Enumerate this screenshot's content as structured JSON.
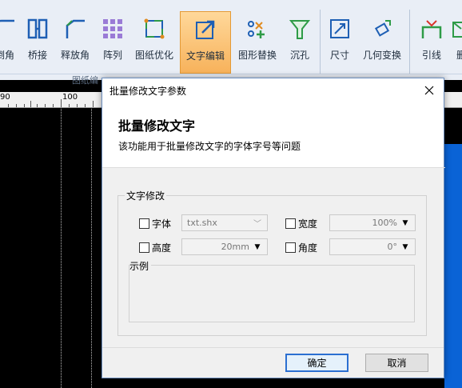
{
  "ribbon": {
    "buttons": [
      {
        "label": "倒角",
        "icon": "chamfer-icon"
      },
      {
        "label": "桥接",
        "icon": "bridge-icon"
      },
      {
        "label": "释放角",
        "icon": "release-corner-icon"
      },
      {
        "label": "阵列",
        "icon": "array-icon"
      },
      {
        "label": "图纸优化",
        "icon": "drawing-optimize-icon"
      },
      {
        "label": "文字编辑",
        "icon": "text-edit-icon"
      },
      {
        "label": "图形替换",
        "icon": "shape-replace-icon"
      },
      {
        "label": "沉孔",
        "icon": "countersink-icon"
      },
      {
        "label": "尺寸",
        "icon": "dimension-icon"
      },
      {
        "label": "几何变换",
        "icon": "geometry-transform-icon"
      },
      {
        "label": "引线",
        "icon": "leader-icon"
      },
      {
        "label": "删",
        "icon": "delete-icon"
      }
    ],
    "group_label": "图纸编"
  },
  "ruler": {
    "labels": [
      "90",
      "100"
    ]
  },
  "dialog": {
    "title": "批量修改文字参数",
    "heading": "批量修改文字",
    "description": "该功能用于批量修改文字的字体字号等问题",
    "group_title": "文字修改",
    "fields": {
      "font": {
        "label": "字体",
        "value": "txt.shx",
        "checked": false
      },
      "width": {
        "label": "宽度",
        "value": "100%",
        "checked": false
      },
      "height": {
        "label": "高度",
        "value": "20mm",
        "checked": false
      },
      "angle": {
        "label": "角度",
        "value": "0°",
        "checked": false
      }
    },
    "example_label": "示例",
    "ok_label": "确定",
    "cancel_label": "取消"
  },
  "colors": {
    "ribbon_bg": "#e9eef6",
    "active_button": "#f7b25b",
    "icon_blue": "#1e5fb4",
    "icon_green": "#2e9b47",
    "canvas_bg": "#000000",
    "shape_blue": "#0a63d6",
    "primary_border": "#2b6fd1"
  }
}
